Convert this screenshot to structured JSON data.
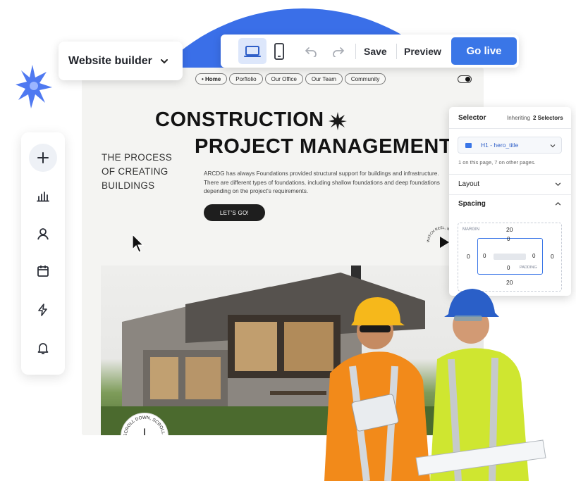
{
  "app": {
    "builder_label": "Website builder"
  },
  "toolbar": {
    "save_label": "Save",
    "preview_label": "Preview",
    "golive_label": "Go live"
  },
  "site": {
    "nav": [
      "• Home",
      "Porftolio",
      "Our Office",
      "Our Team",
      "Community"
    ],
    "title_line1": "CONSTRUCTION",
    "title_line2": "PROJECT MANAGEMENT",
    "tagline": "THE PROCESS OF CREATING BUILDINGS",
    "description": "ARCDG has always Foundations provided structural support for buildings and infrastructure. There are different types of foundations, including shallow foundations and deep foundations depending on the project's requirements.",
    "cta_label": "LET'S GO!",
    "scroll_badge": "SCROLL DOWN, SCROLL DOWN,",
    "watch_badge": "WATCH REEL, WATCH REEL,"
  },
  "inspector": {
    "selector_label": "Selector",
    "inheriting_prefix": "Inheriting",
    "inheriting_count": "2 Selectors",
    "selector_value": "H1 - hero_title",
    "selector_note": "1 on this page, 7 on other pages.",
    "layout_label": "Layout",
    "spacing_label": "Spacing",
    "margin_label": "MARGIN",
    "padding_label": "PADDING",
    "margin_top": "20",
    "margin_bottom": "20",
    "margin_left": "0",
    "margin_right": "0",
    "padding_top": "0",
    "padding_bottom": "0",
    "padding_left": "0",
    "padding_right": "0"
  },
  "colors": {
    "accent": "#3a76e7",
    "blob": "#3a6fe8",
    "selected_device": "#dde7fb"
  },
  "icons": {
    "sidebar": [
      "plus-icon",
      "bar-chart-icon",
      "user-icon",
      "calendar-icon",
      "lightning-icon",
      "bell-icon"
    ],
    "toolbar": [
      "desktop-icon",
      "mobile-icon",
      "undo-icon",
      "redo-icon"
    ]
  }
}
